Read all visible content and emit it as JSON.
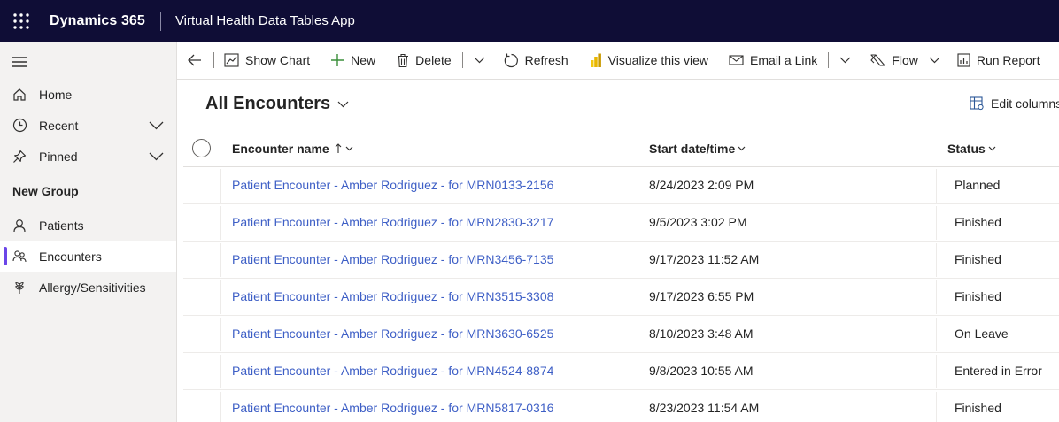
{
  "topbar": {
    "brand": "Dynamics 365",
    "app_name": "Virtual Health Data Tables App"
  },
  "sidebar": {
    "items": [
      {
        "label": "Home",
        "icon": "home-icon"
      },
      {
        "label": "Recent",
        "icon": "clock-icon"
      },
      {
        "label": "Pinned",
        "icon": "pin-icon"
      }
    ],
    "group_title": "New Group",
    "group_items": [
      {
        "label": "Patients",
        "icon": "person-icon"
      },
      {
        "label": "Encounters",
        "icon": "people-icon",
        "selected": true
      },
      {
        "label": "Allergy/Sensitivities",
        "icon": "plant-icon"
      }
    ]
  },
  "commandbar": {
    "show_chart": "Show Chart",
    "new": "New",
    "delete": "Delete",
    "refresh": "Refresh",
    "visualize": "Visualize this view",
    "email_link": "Email a Link",
    "flow": "Flow",
    "run_report": "Run Report"
  },
  "view": {
    "title": "All Encounters",
    "edit_columns": "Edit columns"
  },
  "grid": {
    "columns": {
      "name": "Encounter name",
      "start": "Start date/time",
      "status": "Status"
    },
    "rows": [
      {
        "name": "Patient Encounter - Amber Rodriguez - for MRN0133-2156",
        "start": "8/24/2023 2:09 PM",
        "status": "Planned"
      },
      {
        "name": "Patient Encounter - Amber Rodriguez - for MRN2830-3217",
        "start": "9/5/2023 3:02 PM",
        "status": "Finished"
      },
      {
        "name": "Patient Encounter - Amber Rodriguez - for MRN3456-7135",
        "start": "9/17/2023 11:52 AM",
        "status": "Finished"
      },
      {
        "name": "Patient Encounter - Amber Rodriguez - for MRN3515-3308",
        "start": "9/17/2023 6:55 PM",
        "status": "Finished"
      },
      {
        "name": "Patient Encounter - Amber Rodriguez - for MRN3630-6525",
        "start": "8/10/2023 3:48 AM",
        "status": "On Leave"
      },
      {
        "name": "Patient Encounter - Amber Rodriguez - for MRN4524-8874",
        "start": "9/8/2023 10:55 AM",
        "status": "Entered in Error"
      },
      {
        "name": "Patient Encounter - Amber Rodriguez - for MRN5817-0316",
        "start": "8/23/2023 11:54 AM",
        "status": "Finished"
      }
    ]
  },
  "colors": {
    "topbar": "#0f0d36",
    "link": "#3e5fc6",
    "selected_indicator": "#6b46e8"
  }
}
